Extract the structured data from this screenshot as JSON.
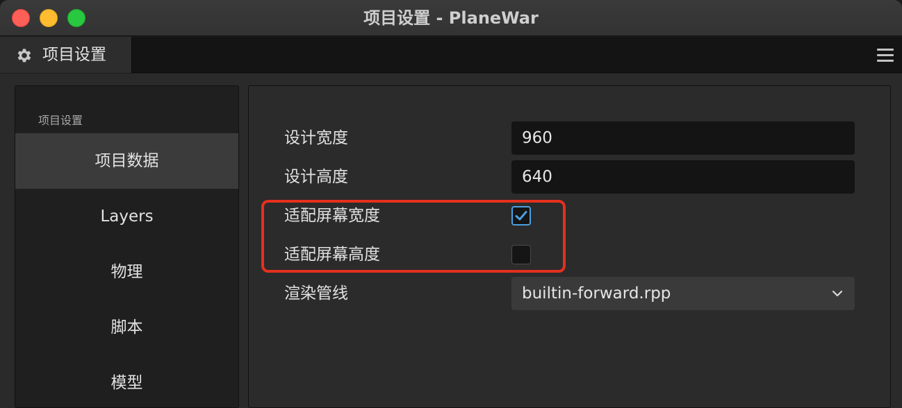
{
  "window": {
    "title": "项目设置 - PlaneWar"
  },
  "tab": {
    "label": "项目设置",
    "icon": "gear-icon"
  },
  "menu": {
    "icon": "hamburger-menu-icon"
  },
  "sidebar": {
    "heading": "项目设置",
    "items": [
      {
        "label": "项目数据",
        "active": true
      },
      {
        "label": "Layers",
        "active": false
      },
      {
        "label": "物理",
        "active": false
      },
      {
        "label": "脚本",
        "active": false
      },
      {
        "label": "模型",
        "active": false
      }
    ]
  },
  "settings": {
    "design_width": {
      "label": "设计宽度",
      "value": "960"
    },
    "design_height": {
      "label": "设计高度",
      "value": "640"
    },
    "fit_width": {
      "label": "适配屏幕宽度",
      "checked": true
    },
    "fit_height": {
      "label": "适配屏幕高度",
      "checked": false
    },
    "render_pipeline": {
      "label": "渲染管线",
      "value": "builtin-forward.rpp"
    }
  },
  "colors": {
    "highlight": "#e5301d",
    "checkbox_accent": "#4d9fe0"
  }
}
